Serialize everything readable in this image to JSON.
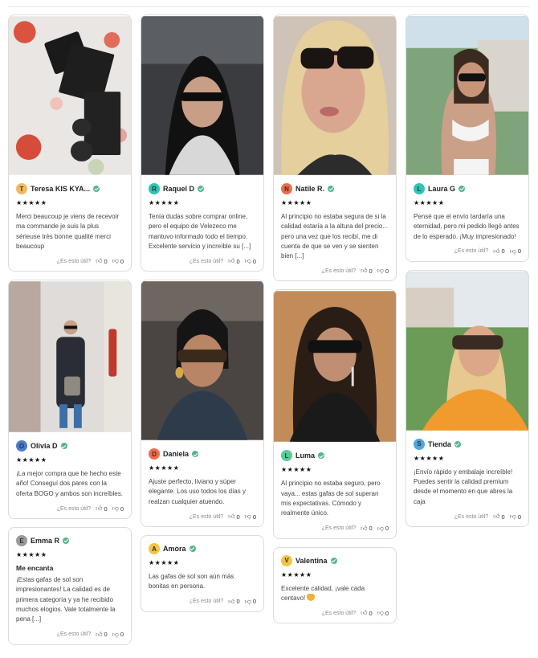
{
  "footer": {
    "helpful_label": "¿Es esto útil?"
  },
  "reviews": [
    {
      "id": 1,
      "avatar": "T",
      "avatar_color": "#f4b860",
      "name": "Teresa KIS KYA...",
      "stars": "★★★★★",
      "text": "Merci beaucoup je viens de recevoir ma commande je suis la plus sérieuse très bonne qualité merci beaucoup",
      "up": "0",
      "down": "0"
    },
    {
      "id": 2,
      "avatar": "R",
      "avatar_color": "#2ec4b6",
      "name": "Raquel D",
      "stars": "★★★★★",
      "text": "Tenía dudas sobre comprar online, pero el equipo de Velezeco me mantuvo informado todo el tiempo. Excelente servicio y increíble su [...]",
      "up": "0",
      "down": "0"
    },
    {
      "id": 3,
      "avatar": "N",
      "avatar_color": "#ef6c4a",
      "name": "Natile R.",
      "stars": "★★★★★",
      "text": "Al principio no estaba segura de si la calidad estaría a la altura del precio... pero una vez que los recibí, me di cuenta de que se ven y se sienten bien [...]",
      "up": "0",
      "down": "0"
    },
    {
      "id": 4,
      "avatar": "L",
      "avatar_color": "#2ec4b6",
      "name": "Laura G",
      "stars": "★★★★★",
      "text": "Pensé que el envío tardaría una eternidad, pero mi pedido llegó antes de lo esperado. ¡Muy impresionado!",
      "up": "0",
      "down": "0"
    },
    {
      "id": 5,
      "avatar": "O",
      "avatar_color": "#4a7bd0",
      "name": "Olivia D",
      "stars": "★★★★★",
      "text": "¡La mejor compra que he hecho este año! Conseguí dos pares con la oferta BOGO y ambos son increíbles.",
      "up": "0",
      "down": "0"
    },
    {
      "id": 6,
      "avatar": "D",
      "avatar_color": "#ef6c4a",
      "name": "Daniela",
      "stars": "★★★★★",
      "text": "Ajuste perfecto, liviano y súper elegante. Los uso todos los días y realzan cualquier atuendo.",
      "up": "0",
      "down": "0"
    },
    {
      "id": 7,
      "avatar": "L",
      "avatar_color": "#57cc99",
      "name": "Luma",
      "stars": "★★★★★",
      "text": "Al principio no estaba seguro, pero vaya... estas gafas de sol superan mis expectativas. Cómodo y realmente único.",
      "up": "0",
      "down": "0"
    },
    {
      "id": 8,
      "avatar": "S",
      "avatar_color": "#4ea8de",
      "name": "Tienda",
      "stars": "★★★★★",
      "text": "¡Envío rápido y embalaje increíble! Puedes sentir la calidad premium desde el momento en que abres la caja",
      "up": "0",
      "down": "0"
    },
    {
      "id": 9,
      "avatar": "E",
      "avatar_color": "#9a9a9a",
      "name": "Emma R",
      "stars": "★★★★★",
      "title": "Me encanta",
      "text": "¡Estas gafas de sol son impresionantes! La calidad es de primera categoría y ya he recibido muchos elogios. Vale totalmente la pena [...]",
      "up": "0",
      "down": "0"
    },
    {
      "id": 10,
      "avatar": "A",
      "avatar_color": "#f4c542",
      "name": "Amora",
      "stars": "★★★★★",
      "text": "Las gafas de sol son aún más bonitas en persona.",
      "up": "0",
      "down": "0"
    },
    {
      "id": 11,
      "avatar": "V",
      "avatar_color": "#f4c542",
      "name": "Valentina",
      "stars": "★★★★★",
      "text": "Excelente calidad, ¡vale cada centavo! ",
      "up": "0",
      "down": "0"
    }
  ]
}
